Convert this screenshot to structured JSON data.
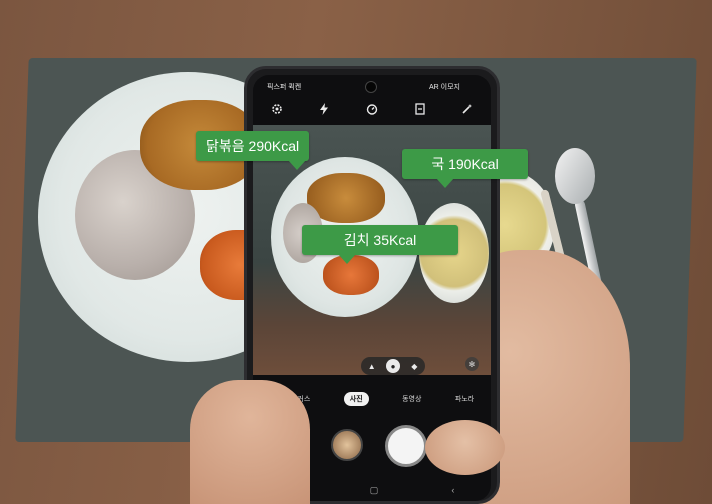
{
  "phone": {
    "status_left": "픽스퍼 퀵켄",
    "status_right": "AR 이모지"
  },
  "toolbar": {
    "icons": [
      "settings-icon",
      "flash-icon",
      "timer-icon",
      "aspect-ratio-icon",
      "magic-icon"
    ]
  },
  "ar_labels": {
    "chicken": "닭볶음 290Kcal",
    "soup": "국 190Kcal",
    "kimchi": "김치 35Kcal"
  },
  "camera": {
    "modes": [
      "라이브 포커스",
      "사진",
      "동영상",
      "파노라"
    ],
    "active_mode": "사진"
  },
  "colors": {
    "label_green": "#3d9a47"
  }
}
